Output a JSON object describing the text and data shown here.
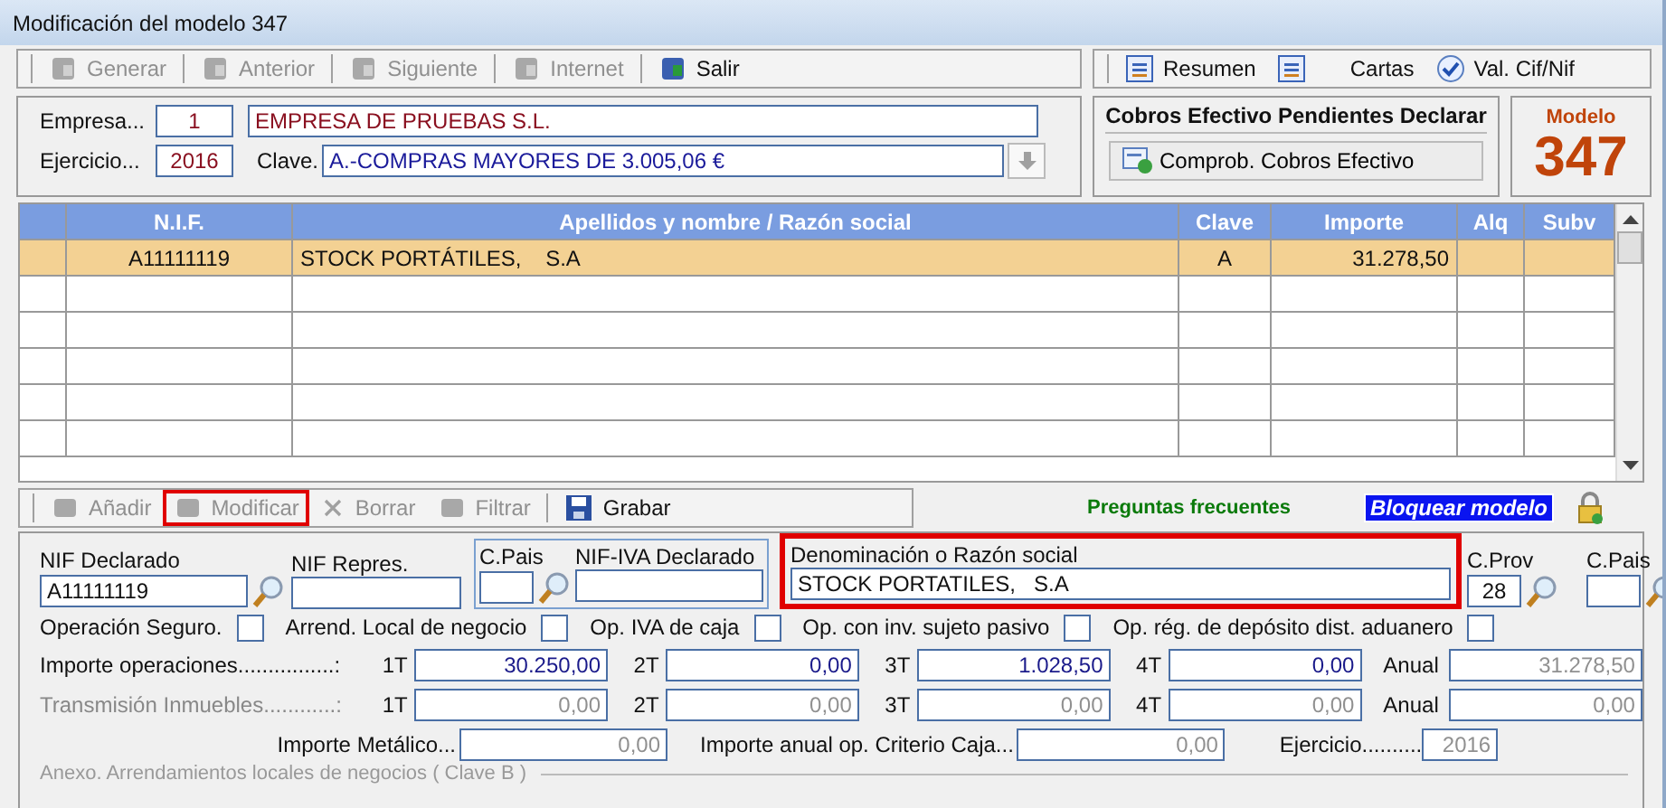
{
  "window": {
    "title": "Modificación del modelo 347"
  },
  "toolbar": [
    {
      "label": "Generar",
      "disabled": true
    },
    {
      "label": "Anterior",
      "disabled": true
    },
    {
      "label": "Siguiente",
      "disabled": true
    },
    {
      "label": "Internet",
      "disabled": true
    },
    {
      "label": "Salir",
      "disabled": false
    }
  ],
  "toolbar_right": [
    {
      "label": "Resumen"
    },
    {
      "label": "Cartas"
    },
    {
      "label": "Val. Cif/Nif"
    }
  ],
  "empresa": {
    "label": "Empresa...",
    "code": "1",
    "name": "EMPRESA DE PRUEBAS S.L."
  },
  "ejercicio": {
    "label": "Ejercicio...",
    "value": "2016"
  },
  "clave": {
    "label": "Clave.",
    "value": "A.-COMPRAS MAYORES DE 3.005,06 €"
  },
  "cobros": {
    "title": "Cobros Efectivo Pendientes Declarar",
    "button": "Comprob. Cobros Efectivo"
  },
  "modelo": {
    "label": "Modelo",
    "number": "347"
  },
  "table": {
    "columns": [
      "N.I.F.",
      "Apellidos y nombre / Razón social",
      "Clave",
      "Importe",
      "Alq",
      "Subv"
    ],
    "rows": [
      {
        "selected": true,
        "cells": [
          "A11111119",
          "STOCK PORTÁTILES,    S.A",
          "A",
          "31.278,50",
          "",
          ""
        ]
      }
    ]
  },
  "edit_toolbar": [
    {
      "label": "Añadir",
      "disabled": true,
      "highlighted": false
    },
    {
      "label": "Modificar",
      "disabled": true,
      "highlighted": true
    },
    {
      "label": "Borrar",
      "disabled": true,
      "highlighted": false
    },
    {
      "label": "Filtrar",
      "disabled": true,
      "highlighted": false
    },
    {
      "label": "Grabar",
      "disabled": false,
      "highlighted": false
    }
  ],
  "faq_link": "Preguntas frecuentes",
  "lock_button": "Bloquear modelo",
  "fields": {
    "nif_declarado": {
      "label": "NIF Declarado",
      "value": "A11111119"
    },
    "nif_repres": {
      "label": "NIF Repres."
    },
    "c_pais": {
      "label": "C.Pais"
    },
    "nif_iva": {
      "label": "NIF-IVA Declarado"
    },
    "denominacion": {
      "label": "Denominación o Razón social",
      "value": "STOCK PORTATILES,   S.A",
      "highlighted": true
    },
    "c_prov": {
      "label": "C.Prov",
      "value": "28"
    },
    "c_pais_2": {
      "label": "C.Pais"
    }
  },
  "checkboxes": [
    {
      "label": "Operación Seguro.",
      "checked": false
    },
    {
      "label": "Arrend. Local de negocio",
      "checked": false
    },
    {
      "label": "Op. IVA de caja",
      "checked": false
    },
    {
      "label": "Op. con inv. sujeto pasivo",
      "checked": false
    },
    {
      "label": "Op. rég. de depósito dist. aduanero",
      "checked": false
    }
  ],
  "importes": [
    {
      "label": "Importe operaciones................:",
      "disabled": false,
      "quarters": [
        {
          "q": "1T",
          "value": "30.250,00"
        },
        {
          "q": "2T",
          "value": "0,00"
        },
        {
          "q": "3T",
          "value": "1.028,50"
        },
        {
          "q": "4T",
          "value": "0,00"
        }
      ],
      "anual_label": "Anual",
      "anual": "31.278,50"
    },
    {
      "label": "Transmisión Inmuebles............:",
      "disabled": true,
      "quarters": [
        {
          "q": "1T",
          "value": "0,00"
        },
        {
          "q": "2T",
          "value": "0,00"
        },
        {
          "q": "3T",
          "value": "0,00"
        },
        {
          "q": "4T",
          "value": "0,00"
        }
      ],
      "anual_label": "Anual",
      "anual": "0,00"
    }
  ],
  "metalico": {
    "label": "Importe Metálico...",
    "value": "0,00"
  },
  "criterio_caja": {
    "label": "Importe anual op. Criterio Caja...",
    "value": "0,00"
  },
  "ejercicio_bottom": {
    "label": "Ejercicio..........",
    "value": "2016"
  },
  "annex": {
    "title": "Anexo. Arrendamientos locales de negocios  ( Clave B )"
  }
}
